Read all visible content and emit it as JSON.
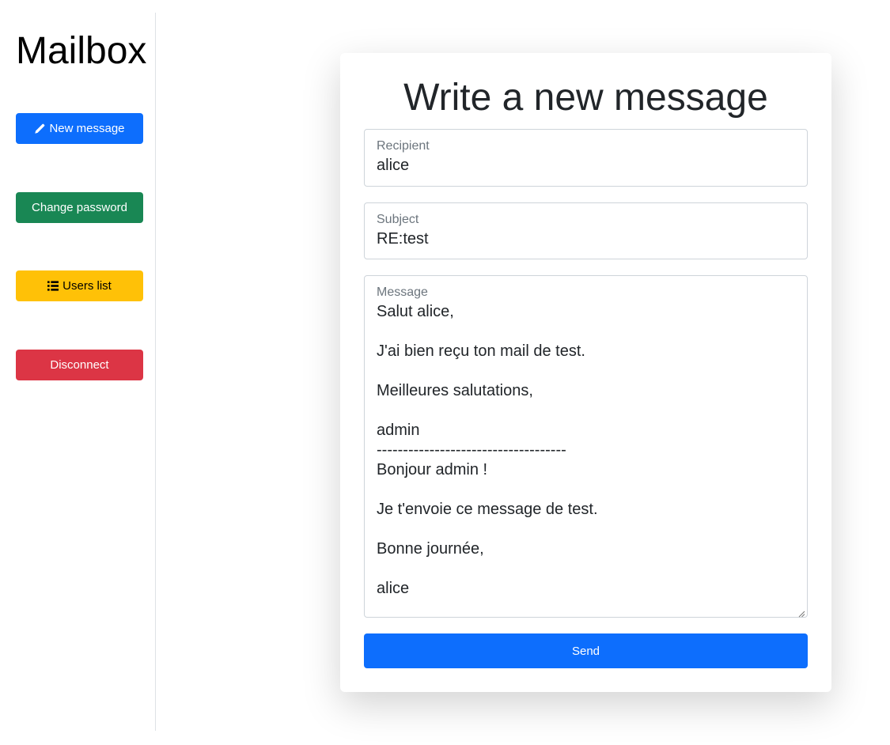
{
  "sidebar": {
    "title": "Mailbox",
    "buttons": {
      "new_message": {
        "label": "New message",
        "icon": "pencil-icon",
        "color": "#0d6efd"
      },
      "change_password": {
        "label": "Change password",
        "color": "#198754"
      },
      "users_list": {
        "label": "Users list",
        "icon": "list-icon",
        "color": "#ffc107"
      },
      "disconnect": {
        "label": "Disconnect",
        "color": "#dc3545"
      }
    }
  },
  "compose": {
    "title": "Write a new message",
    "recipient": {
      "label": "Recipient",
      "value": "alice"
    },
    "subject": {
      "label": "Subject",
      "value": "RE:test"
    },
    "message": {
      "label": "Message",
      "value": "Salut alice,\n\nJ'ai bien reçu ton mail de test.\n\nMeilleures salutations,\n\nadmin\n------------------------------------\nBonjour admin !\n\nJe t'envoie ce message de test.\n\nBonne journée,\n\nalice"
    },
    "send_label": "Send"
  }
}
